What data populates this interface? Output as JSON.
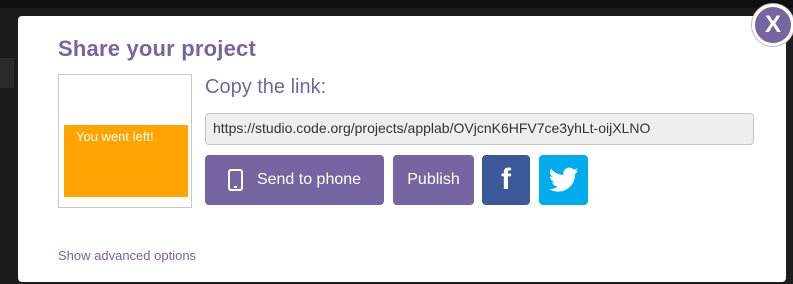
{
  "dialog": {
    "title": "Share your project",
    "thumbnail": {
      "text": "You went left!"
    },
    "copy_label": "Copy the link:",
    "link_value": "https://studio.code.org/projects/applab/OVjcnK6HFV7ce3yhLt-oijXLNO",
    "buttons": {
      "send_to_phone": "Send to phone",
      "publish": "Publish",
      "facebook": "f"
    },
    "advanced_options": "Show advanced options",
    "close_label": "X"
  },
  "colors": {
    "accent": "#7665a0",
    "facebook": "#3b5998",
    "twitter": "#00aced",
    "thumbnail_bg": "#ffa400"
  },
  "icons": {
    "phone": "phone-icon",
    "twitter": "twitter-icon",
    "facebook": "facebook-icon"
  }
}
